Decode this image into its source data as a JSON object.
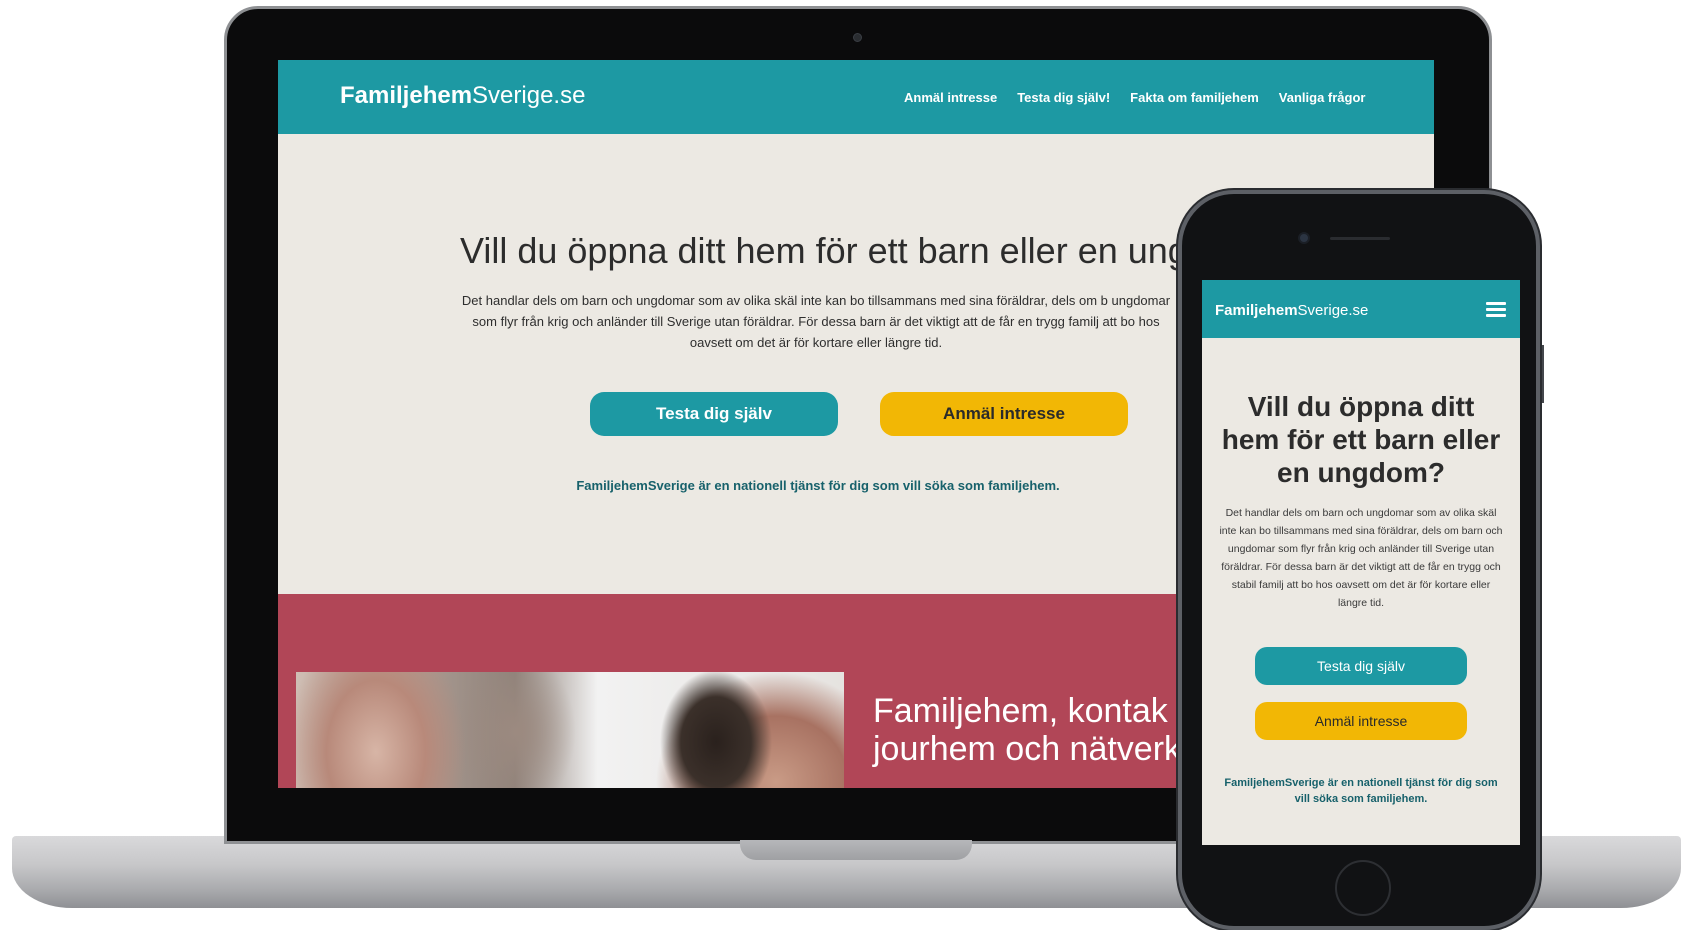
{
  "desktop": {
    "logo": {
      "bold": "Familjehem",
      "light": "Sverige.se"
    },
    "nav": [
      "Anmäl intresse",
      "Testa dig själv!",
      "Fakta om familjehem",
      "Vanliga frågor"
    ],
    "hero": {
      "title": "Vill du öppna ditt hem för ett barn eller en ungd",
      "text": "Det handlar dels om barn och ungdomar som av olika skäl inte kan bo tillsammans med sina föräldrar, dels om b ungdomar som flyr från krig och anländer till Sverige utan föräldrar. För dessa barn är det viktigt att de får en trygg familj att bo hos oavsett om det är för kortare eller längre tid.",
      "buttons": [
        "Testa dig själv",
        "Anmäl intresse"
      ],
      "note": "FamiljehemSverige är en nationell tjänst för dig som vill söka som familjehem."
    },
    "band": {
      "line1": "Familjehem, kontak",
      "line2": "jourhem och nätverk"
    }
  },
  "mobile": {
    "logo": {
      "bold": "Familjehem",
      "light": "Sverige.se"
    },
    "menu_icon": "hamburger-menu-icon",
    "hero": {
      "title": "Vill du öppna ditt hem för ett barn eller en ungdom?",
      "text": "Det handlar dels om barn och ungdomar som av olika skäl inte kan bo tillsammans med sina föräldrar, dels om barn och ungdomar som flyr från krig och anländer till Sverige utan föräldrar. För dessa barn är det viktigt att de får en trygg och stabil familj att bo hos oavsett om det är för kortare eller längre tid.",
      "buttons": [
        "Testa dig själv",
        "Anmäl intresse"
      ],
      "note": "FamiljehemSverige är en nationell tjänst för dig som vill söka som familjehem."
    }
  },
  "colors": {
    "teal": "#1d99a3",
    "yellow": "#f2b705",
    "band": "#b14657",
    "page_bg": "#ece9e3",
    "note_text": "#17616b"
  }
}
